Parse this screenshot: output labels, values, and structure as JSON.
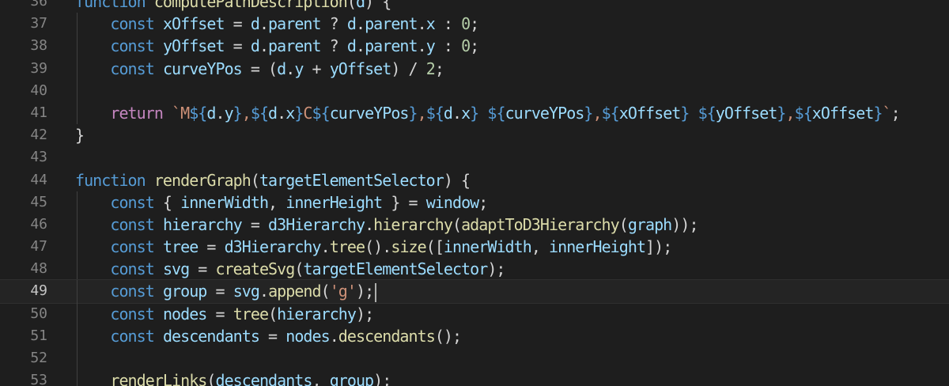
{
  "editor": {
    "language": "javascript",
    "current_line": "49",
    "lines": [
      {
        "n": "36",
        "guide": false,
        "tokens": [
          [
            "kw",
            "function"
          ],
          [
            "op",
            " "
          ],
          [
            "fn",
            "computePathDescription"
          ],
          [
            "op",
            "("
          ],
          [
            "var",
            "d"
          ],
          [
            "op",
            ") {"
          ]
        ]
      },
      {
        "n": "37",
        "guide": true,
        "tokens": [
          [
            "op",
            "    "
          ],
          [
            "kw",
            "const"
          ],
          [
            "op",
            " "
          ],
          [
            "var",
            "xOffset"
          ],
          [
            "op",
            " = "
          ],
          [
            "var",
            "d"
          ],
          [
            "op",
            "."
          ],
          [
            "var",
            "parent"
          ],
          [
            "op",
            " ? "
          ],
          [
            "var",
            "d"
          ],
          [
            "op",
            "."
          ],
          [
            "var",
            "parent"
          ],
          [
            "op",
            "."
          ],
          [
            "var",
            "x"
          ],
          [
            "op",
            " : "
          ],
          [
            "num",
            "0"
          ],
          [
            "op",
            ";"
          ]
        ]
      },
      {
        "n": "38",
        "guide": true,
        "tokens": [
          [
            "op",
            "    "
          ],
          [
            "kw",
            "const"
          ],
          [
            "op",
            " "
          ],
          [
            "var",
            "yOffset"
          ],
          [
            "op",
            " = "
          ],
          [
            "var",
            "d"
          ],
          [
            "op",
            "."
          ],
          [
            "var",
            "parent"
          ],
          [
            "op",
            " ? "
          ],
          [
            "var",
            "d"
          ],
          [
            "op",
            "."
          ],
          [
            "var",
            "parent"
          ],
          [
            "op",
            "."
          ],
          [
            "var",
            "y"
          ],
          [
            "op",
            " : "
          ],
          [
            "num",
            "0"
          ],
          [
            "op",
            ";"
          ]
        ]
      },
      {
        "n": "39",
        "guide": true,
        "tokens": [
          [
            "op",
            "    "
          ],
          [
            "kw",
            "const"
          ],
          [
            "op",
            " "
          ],
          [
            "var",
            "curveYPos"
          ],
          [
            "op",
            " = ("
          ],
          [
            "var",
            "d"
          ],
          [
            "op",
            "."
          ],
          [
            "var",
            "y"
          ],
          [
            "op",
            " + "
          ],
          [
            "var",
            "yOffset"
          ],
          [
            "op",
            ") / "
          ],
          [
            "num",
            "2"
          ],
          [
            "op",
            ";"
          ]
        ]
      },
      {
        "n": "40",
        "guide": true,
        "tokens": []
      },
      {
        "n": "41",
        "guide": true,
        "tokens": [
          [
            "op",
            "    "
          ],
          [
            "ctl",
            "return"
          ],
          [
            "op",
            " "
          ],
          [
            "str",
            "`M"
          ],
          [
            "kw",
            "${"
          ],
          [
            "var",
            "d"
          ],
          [
            "op",
            "."
          ],
          [
            "var",
            "y"
          ],
          [
            "kw",
            "}"
          ],
          [
            "str",
            ","
          ],
          [
            "kw",
            "${"
          ],
          [
            "var",
            "d"
          ],
          [
            "op",
            "."
          ],
          [
            "var",
            "x"
          ],
          [
            "kw",
            "}"
          ],
          [
            "str",
            "C"
          ],
          [
            "kw",
            "${"
          ],
          [
            "var",
            "curveYPos"
          ],
          [
            "kw",
            "}"
          ],
          [
            "str",
            ","
          ],
          [
            "kw",
            "${"
          ],
          [
            "var",
            "d"
          ],
          [
            "op",
            "."
          ],
          [
            "var",
            "x"
          ],
          [
            "kw",
            "}"
          ],
          [
            "str",
            " "
          ],
          [
            "kw",
            "${"
          ],
          [
            "var",
            "curveYPos"
          ],
          [
            "kw",
            "}"
          ],
          [
            "str",
            ","
          ],
          [
            "kw",
            "${"
          ],
          [
            "var",
            "xOffset"
          ],
          [
            "kw",
            "}"
          ],
          [
            "str",
            " "
          ],
          [
            "kw",
            "${"
          ],
          [
            "var",
            "yOffset"
          ],
          [
            "kw",
            "}"
          ],
          [
            "str",
            ","
          ],
          [
            "kw",
            "${"
          ],
          [
            "var",
            "xOffset"
          ],
          [
            "kw",
            "}"
          ],
          [
            "str",
            "`"
          ],
          [
            "op",
            ";"
          ]
        ]
      },
      {
        "n": "42",
        "guide": false,
        "tokens": [
          [
            "op",
            "}"
          ]
        ]
      },
      {
        "n": "43",
        "guide": false,
        "tokens": []
      },
      {
        "n": "44",
        "guide": false,
        "tokens": [
          [
            "kw",
            "function"
          ],
          [
            "op",
            " "
          ],
          [
            "fn",
            "renderGraph"
          ],
          [
            "op",
            "("
          ],
          [
            "var",
            "targetElementSelector"
          ],
          [
            "op",
            ") {"
          ]
        ]
      },
      {
        "n": "45",
        "guide": true,
        "tokens": [
          [
            "op",
            "    "
          ],
          [
            "kw",
            "const"
          ],
          [
            "op",
            " { "
          ],
          [
            "var",
            "innerWidth"
          ],
          [
            "op",
            ", "
          ],
          [
            "var",
            "innerHeight"
          ],
          [
            "op",
            " } = "
          ],
          [
            "var",
            "window"
          ],
          [
            "op",
            ";"
          ]
        ]
      },
      {
        "n": "46",
        "guide": true,
        "tokens": [
          [
            "op",
            "    "
          ],
          [
            "kw",
            "const"
          ],
          [
            "op",
            " "
          ],
          [
            "var",
            "hierarchy"
          ],
          [
            "op",
            " = "
          ],
          [
            "var",
            "d3Hierarchy"
          ],
          [
            "op",
            "."
          ],
          [
            "fn",
            "hierarchy"
          ],
          [
            "op",
            "("
          ],
          [
            "fn",
            "adaptToD3Hierarchy"
          ],
          [
            "op",
            "("
          ],
          [
            "var",
            "graph"
          ],
          [
            "op",
            "));"
          ]
        ]
      },
      {
        "n": "47",
        "guide": true,
        "tokens": [
          [
            "op",
            "    "
          ],
          [
            "kw",
            "const"
          ],
          [
            "op",
            " "
          ],
          [
            "var",
            "tree"
          ],
          [
            "op",
            " = "
          ],
          [
            "var",
            "d3Hierarchy"
          ],
          [
            "op",
            "."
          ],
          [
            "fn",
            "tree"
          ],
          [
            "op",
            "()."
          ],
          [
            "fn",
            "size"
          ],
          [
            "op",
            "(["
          ],
          [
            "var",
            "innerWidth"
          ],
          [
            "op",
            ", "
          ],
          [
            "var",
            "innerHeight"
          ],
          [
            "op",
            "]);"
          ]
        ]
      },
      {
        "n": "48",
        "guide": true,
        "tokens": [
          [
            "op",
            "    "
          ],
          [
            "kw",
            "const"
          ],
          [
            "op",
            " "
          ],
          [
            "var",
            "svg"
          ],
          [
            "op",
            " = "
          ],
          [
            "fn",
            "createSvg"
          ],
          [
            "op",
            "("
          ],
          [
            "var",
            "targetElementSelector"
          ],
          [
            "op",
            ");"
          ]
        ]
      },
      {
        "n": "49",
        "guide": true,
        "tokens": [
          [
            "op",
            "    "
          ],
          [
            "kw",
            "const"
          ],
          [
            "op",
            " "
          ],
          [
            "var",
            "group"
          ],
          [
            "op",
            " = "
          ],
          [
            "var",
            "svg"
          ],
          [
            "op",
            "."
          ],
          [
            "fn",
            "append"
          ],
          [
            "op",
            "("
          ],
          [
            "str",
            "'g'"
          ],
          [
            "op",
            ");"
          ]
        ]
      },
      {
        "n": "50",
        "guide": true,
        "tokens": [
          [
            "op",
            "    "
          ],
          [
            "kw",
            "const"
          ],
          [
            "op",
            " "
          ],
          [
            "var",
            "nodes"
          ],
          [
            "op",
            " = "
          ],
          [
            "fn",
            "tree"
          ],
          [
            "op",
            "("
          ],
          [
            "var",
            "hierarchy"
          ],
          [
            "op",
            ");"
          ]
        ]
      },
      {
        "n": "51",
        "guide": true,
        "tokens": [
          [
            "op",
            "    "
          ],
          [
            "kw",
            "const"
          ],
          [
            "op",
            " "
          ],
          [
            "var",
            "descendants"
          ],
          [
            "op",
            " = "
          ],
          [
            "var",
            "nodes"
          ],
          [
            "op",
            "."
          ],
          [
            "fn",
            "descendants"
          ],
          [
            "op",
            "();"
          ]
        ]
      },
      {
        "n": "52",
        "guide": true,
        "tokens": []
      },
      {
        "n": "53",
        "guide": true,
        "tokens": [
          [
            "op",
            "    "
          ],
          [
            "fn",
            "renderLinks"
          ],
          [
            "op",
            "("
          ],
          [
            "var",
            "descendants"
          ],
          [
            "op",
            ", "
          ],
          [
            "var",
            "group"
          ],
          [
            "op",
            ");"
          ]
        ]
      }
    ]
  }
}
